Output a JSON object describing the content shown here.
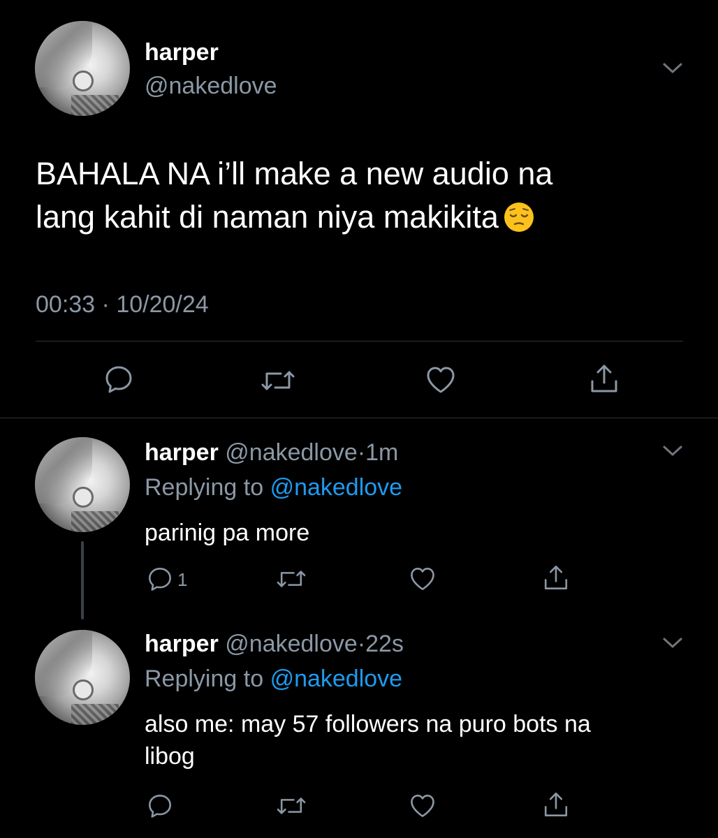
{
  "main_tweet": {
    "display_name": "harper",
    "handle": "@nakedlove",
    "text_line1": "BAHALA NA i’ll make a new audio na",
    "text_line2": "lang kahit di naman niya makikita",
    "emoji": "pensive-face",
    "time": "00:33",
    "separator": "·",
    "date": "10/20/24"
  },
  "replies": [
    {
      "display_name": "harper",
      "handle": "@nakedlove",
      "dot": "·",
      "age": "1m",
      "replying_prefix": "Replying to",
      "replying_to": "@nakedlove",
      "text_lines": [
        "parinig pa more"
      ],
      "reply_count": "1"
    },
    {
      "display_name": "harper",
      "handle": "@nakedlove",
      "dot": "·",
      "age": "22s",
      "replying_prefix": "Replying to",
      "replying_to": "@nakedlove",
      "text_lines": [
        "also me: may 57 followers na puro bots na",
        "libog"
      ],
      "reply_count": ""
    }
  ],
  "colors": {
    "background": "#000000",
    "text": "#ffffff",
    "muted": "#8b98a5",
    "link": "#1d9bf0",
    "divider": "#2f3336"
  },
  "icons": [
    "chevron-down-icon",
    "reply-icon",
    "retweet-icon",
    "like-icon",
    "share-icon"
  ]
}
